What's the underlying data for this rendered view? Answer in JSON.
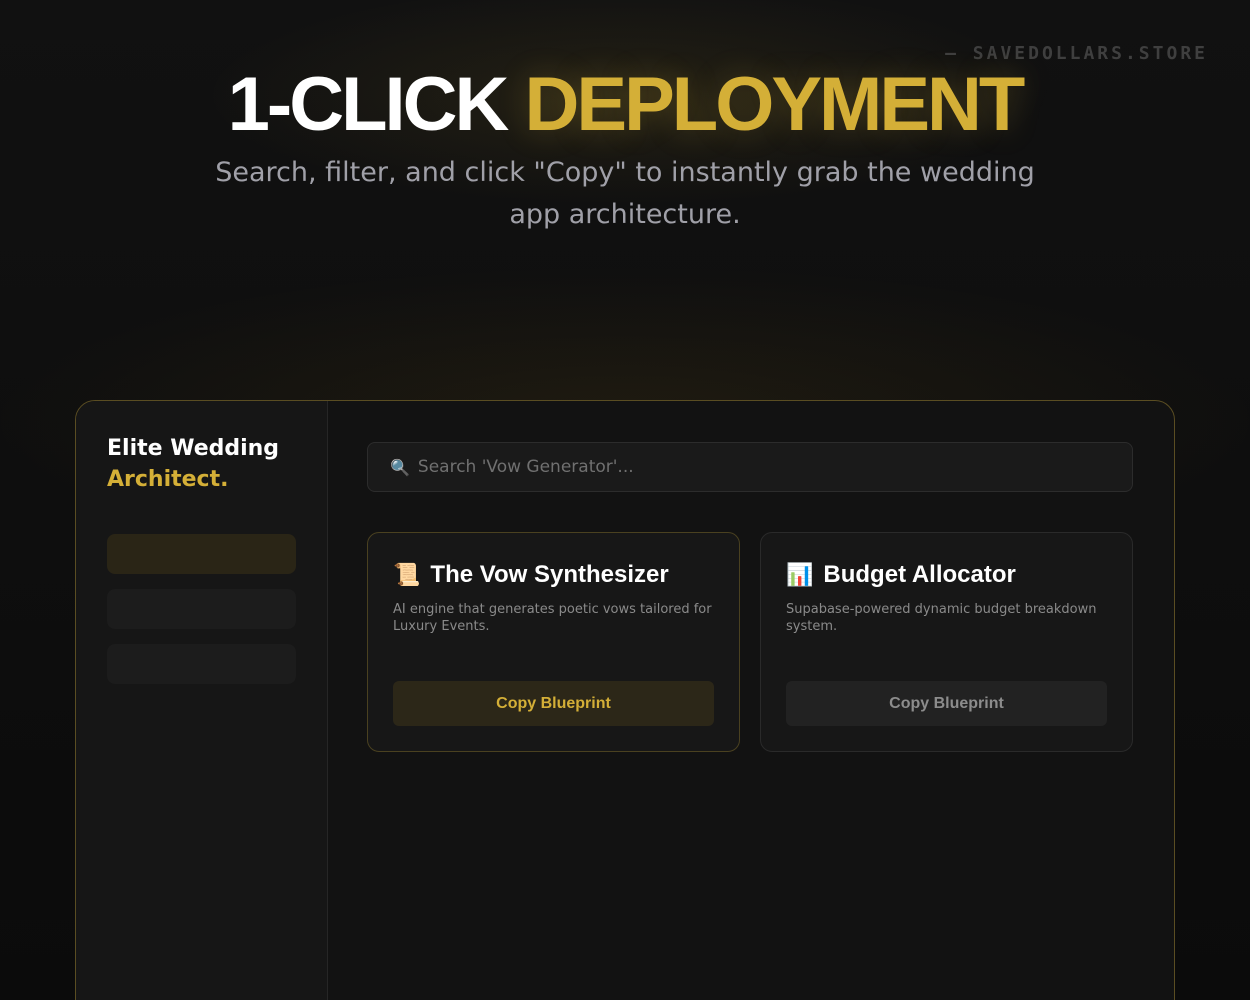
{
  "header": {
    "brand_tag": "— SAVEDOLLARS.STORE",
    "title_white": "1-CLICK ",
    "title_gold": "DEPLOYMENT",
    "subtitle": "Search, filter, and click \"Copy\" to instantly grab the wedding app architecture."
  },
  "sidebar": {
    "logo_line1": "Elite Wedding",
    "logo_line2": "Architect."
  },
  "search": {
    "placeholder": "Search 'Vow Generator'..."
  },
  "cards": [
    {
      "icon": "📜",
      "title": "The Vow Synthesizer",
      "description": "AI engine that generates poetic vows tailored for Luxury Events.",
      "button_label": "Copy Blueprint"
    },
    {
      "icon": "📊",
      "title": "Budget Allocator",
      "description": "Supabase-powered dynamic budget breakdown system.",
      "button_label": "Copy Blueprint"
    }
  ],
  "colors": {
    "accent": "#d4af37",
    "background": "#0d0d0d"
  }
}
